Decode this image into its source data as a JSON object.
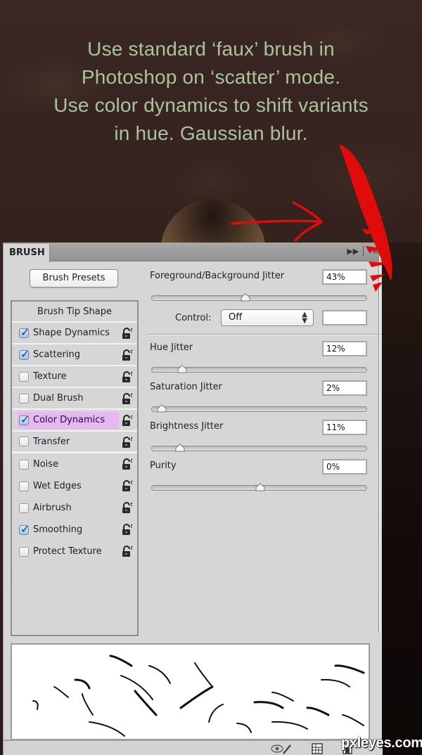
{
  "caption": {
    "lines": [
      "Use standard ‘faux’ brush in",
      "Photoshop on ‘scatter’ mode.",
      "Use color dynamics to shift variants",
      "in hue. Gaussian blur."
    ],
    "color": "#a9c49d"
  },
  "annotation": {
    "arrow_icon": "red-arrow-icon",
    "stroke_color": "#e00b0b"
  },
  "panel": {
    "tab_label": "BRUSH",
    "collapse_icon": "double-chevron-right-icon",
    "menu_icon": "panel-menu-icon",
    "brush_presets_label": "Brush Presets",
    "list_header": "Brush Tip Shape",
    "items": [
      {
        "label": "Shape Dynamics",
        "checked": true,
        "selected": false,
        "locked": false
      },
      {
        "label": "Scattering",
        "checked": true,
        "selected": false,
        "locked": false
      },
      {
        "label": "Texture",
        "checked": false,
        "selected": false,
        "locked": false
      },
      {
        "label": "Dual Brush",
        "checked": false,
        "selected": false,
        "locked": false
      },
      {
        "label": "Color Dynamics",
        "checked": true,
        "selected": true,
        "locked": false
      },
      {
        "label": "Transfer",
        "checked": false,
        "selected": false,
        "locked": false
      },
      {
        "label": "Noise",
        "checked": false,
        "selected": false,
        "locked": false
      },
      {
        "label": "Wet Edges",
        "checked": false,
        "selected": false,
        "locked": false
      },
      {
        "label": "Airbrush",
        "checked": false,
        "selected": false,
        "locked": false
      },
      {
        "label": "Smoothing",
        "checked": true,
        "selected": false,
        "locked": false
      },
      {
        "label": "Protect Texture",
        "checked": false,
        "selected": false,
        "locked": false
      }
    ],
    "selection_color": "#e8b6f2",
    "controls": {
      "fg_bg_jitter": {
        "label": "Foreground/Background Jitter",
        "value": "43%",
        "slider": 0.43
      },
      "control": {
        "label": "Control:",
        "selected": "Off",
        "extra_value": ""
      },
      "hue_jitter": {
        "label": "Hue Jitter",
        "value": "12%",
        "slider": 0.12
      },
      "saturation_jitter": {
        "label": "Saturation Jitter",
        "value": "2%",
        "slider": 0.02
      },
      "brightness_jitter": {
        "label": "Brightness Jitter",
        "value": "11%",
        "slider": 0.11
      },
      "purity": {
        "label": "Purity",
        "value": "0%",
        "slider": 0.5
      }
    },
    "bottom_icons": [
      "eye-brush-icon",
      "grid-icon",
      "new-preset-icon"
    ]
  },
  "watermark": "pxleyes.com"
}
